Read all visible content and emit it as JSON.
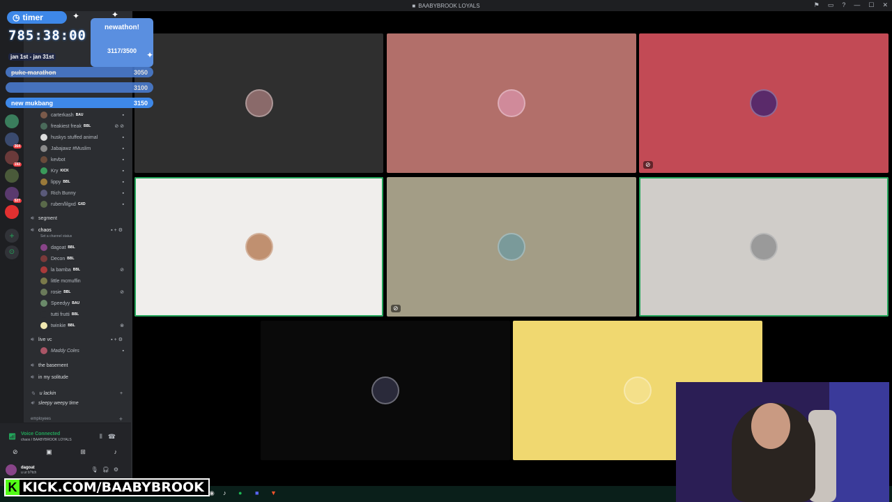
{
  "window": {
    "title": "BAABYBROOK LOYALS"
  },
  "colors": {
    "accent": "#3e88e8",
    "kick_green": "#53fc18",
    "voice_green": "#23a55a"
  },
  "overlay": {
    "timer_label": "timer",
    "timer_value": "785:38:00",
    "date_range": "jan 1st - jan 31st",
    "goal_title": "newathon!",
    "goal_value": "3117/3500",
    "goals": [
      {
        "label": "puke marathon",
        "value": "3050"
      },
      {
        "label": "",
        "value": "3100"
      },
      {
        "label": "new mukbang",
        "value": "3150"
      }
    ]
  },
  "channels": {
    "members_top": [
      {
        "name": "carterkash",
        "tag": "BAU"
      },
      {
        "name": "freakiest freak",
        "tag": "BBL"
      },
      {
        "name": "huskys stuffed animal",
        "tag": ""
      },
      {
        "name": "Jabajawz #Muslim",
        "tag": ""
      },
      {
        "name": "kevbot",
        "tag": ""
      },
      {
        "name": "Kry",
        "tag": "KICK"
      },
      {
        "name": "lippy",
        "tag": "BBL"
      },
      {
        "name": "Rich Bunny",
        "tag": ""
      },
      {
        "name": "ruben/lilgxd",
        "tag": "GXD"
      }
    ],
    "segment_channel": "segment",
    "chaos_channel": "chaos",
    "chaos_status": "Set a channel status",
    "chaos_members": [
      {
        "name": "dagoat",
        "tag": "BBL"
      },
      {
        "name": "Decon",
        "tag": "BBL"
      },
      {
        "name": "la bamba",
        "tag": "BBL"
      },
      {
        "name": "little mcmuffin",
        "tag": ""
      },
      {
        "name": "rosie",
        "tag": "BBL"
      },
      {
        "name": "Speedyy",
        "tag": "BAU"
      },
      {
        "name": "tutti frutti",
        "tag": "BBL"
      },
      {
        "name": "twinkie",
        "tag": "BBL"
      }
    ],
    "live_vc": "live vc",
    "live_vc_member": "Maddy Coles",
    "basement": "the basement",
    "solitude": "in my solitude",
    "ulackin": "u lackin",
    "sleepy": "sleepy weepy time",
    "employees": "employees"
  },
  "voice": {
    "status": "Voice Connected",
    "location": "chaos / BAABYBROOK LOYALS"
  },
  "user": {
    "name": "dagoat",
    "status": "u ur b?tch"
  },
  "kick_banner": {
    "text": "KICK.COM/BAABYBROOK",
    "k": "K"
  },
  "tiles": [
    {
      "bg": "#2f2f2f",
      "avatar": "#8a6a6a"
    },
    {
      "bg": "#b26f6a",
      "avatar": "#d08a9a"
    },
    {
      "bg": "#c24a55",
      "avatar": "#5a2a6a"
    },
    {
      "bg": "#f0eeec",
      "avatar": "#c09070"
    },
    {
      "bg": "#a39d86",
      "avatar": "#7a9a9a"
    },
    {
      "bg": "#d0cdc9",
      "avatar": "#9a9a9a"
    },
    {
      "bg": "#0a0a0a",
      "avatar": "#2a2a3a"
    },
    {
      "bg": "#f0d870",
      "avatar": "#f4e08a"
    }
  ]
}
